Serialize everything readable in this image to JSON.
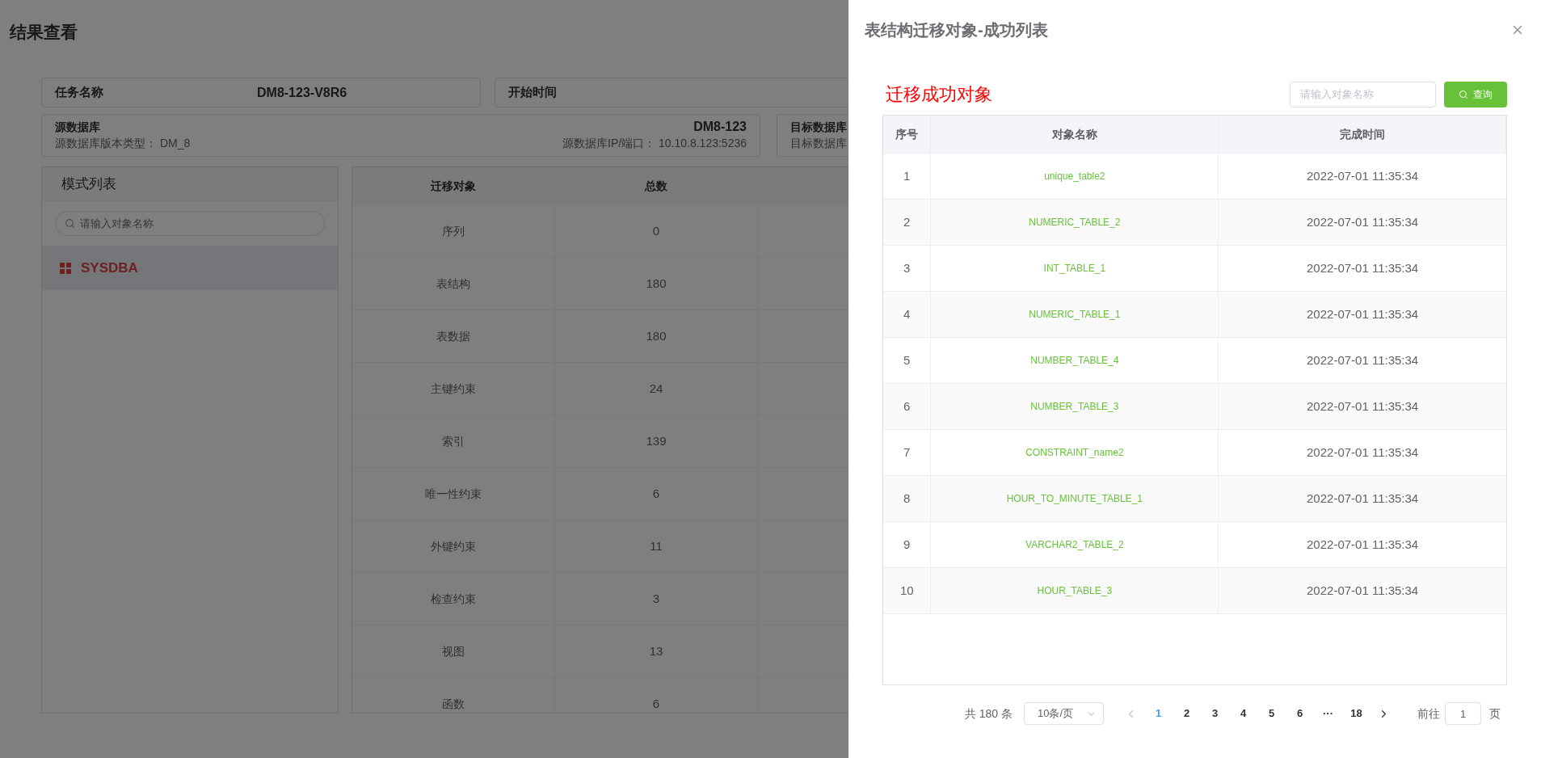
{
  "page": {
    "title": "结果查看",
    "task": {
      "label": "任务名称",
      "value": "DM8-123-V8R6"
    },
    "start_time": {
      "label": "开始时间"
    },
    "source": {
      "label": "源数据库",
      "value": "DM8-123",
      "version": "源数据库版本类型： DM_8",
      "ip": "源数据库IP/端口： 10.10.8.123:5236"
    },
    "target": {
      "label": "目标数据库",
      "sublabel": "目标数据库"
    },
    "schema_panel": {
      "title": "模式列表",
      "placeholder": "请输入对象名称",
      "items": [
        {
          "name": "SYSDBA",
          "selected": true
        }
      ]
    },
    "summary_table": {
      "columns": [
        "迁移对象",
        "总数"
      ],
      "rows": [
        {
          "object": "序列",
          "total": "0"
        },
        {
          "object": "表结构",
          "total": "180"
        },
        {
          "object": "表数据",
          "total": "180"
        },
        {
          "object": "主键约束",
          "total": "24"
        },
        {
          "object": "索引",
          "total": "139"
        },
        {
          "object": "唯一性约束",
          "total": "6"
        },
        {
          "object": "外键约束",
          "total": "11"
        },
        {
          "object": "检查约束",
          "total": "3"
        },
        {
          "object": "视图",
          "total": "13"
        },
        {
          "object": "函数",
          "total": "6"
        }
      ]
    }
  },
  "drawer": {
    "title": "表结构迁移对象-成功列表",
    "heading": "迁移成功对象",
    "placeholder": "请输入对象名称",
    "query_button": "查询",
    "columns": [
      "序号",
      "对象名称",
      "完成时间"
    ],
    "rows": [
      {
        "index": "1",
        "name": "unique_table2",
        "time": "2022-07-01 11:35:34"
      },
      {
        "index": "2",
        "name": "NUMERIC_TABLE_2",
        "time": "2022-07-01 11:35:34"
      },
      {
        "index": "3",
        "name": "INT_TABLE_1",
        "time": "2022-07-01 11:35:34"
      },
      {
        "index": "4",
        "name": "NUMERIC_TABLE_1",
        "time": "2022-07-01 11:35:34"
      },
      {
        "index": "5",
        "name": "NUMBER_TABLE_4",
        "time": "2022-07-01 11:35:34"
      },
      {
        "index": "6",
        "name": "NUMBER_TABLE_3",
        "time": "2022-07-01 11:35:34"
      },
      {
        "index": "7",
        "name": "CONSTRAINT_name2",
        "time": "2022-07-01 11:35:34"
      },
      {
        "index": "8",
        "name": "HOUR_TO_MINUTE_TABLE_1",
        "time": "2022-07-01 11:35:34"
      },
      {
        "index": "9",
        "name": "VARCHAR2_TABLE_2",
        "time": "2022-07-01 11:35:34"
      },
      {
        "index": "10",
        "name": "HOUR_TABLE_3",
        "time": "2022-07-01 11:35:34"
      }
    ],
    "pagination": {
      "total": "共 180 条",
      "page_size": "10条/页",
      "pages": [
        {
          "label": "1",
          "selected": true
        },
        {
          "label": "2",
          "selected": false
        },
        {
          "label": "3",
          "selected": false
        },
        {
          "label": "4",
          "selected": false
        },
        {
          "label": "5",
          "selected": false
        },
        {
          "label": "6",
          "selected": false
        },
        {
          "label": "···",
          "selected": false
        },
        {
          "label": "18",
          "selected": false
        }
      ],
      "goto_label": "前往",
      "goto_value": "1",
      "page_unit": "页"
    }
  }
}
